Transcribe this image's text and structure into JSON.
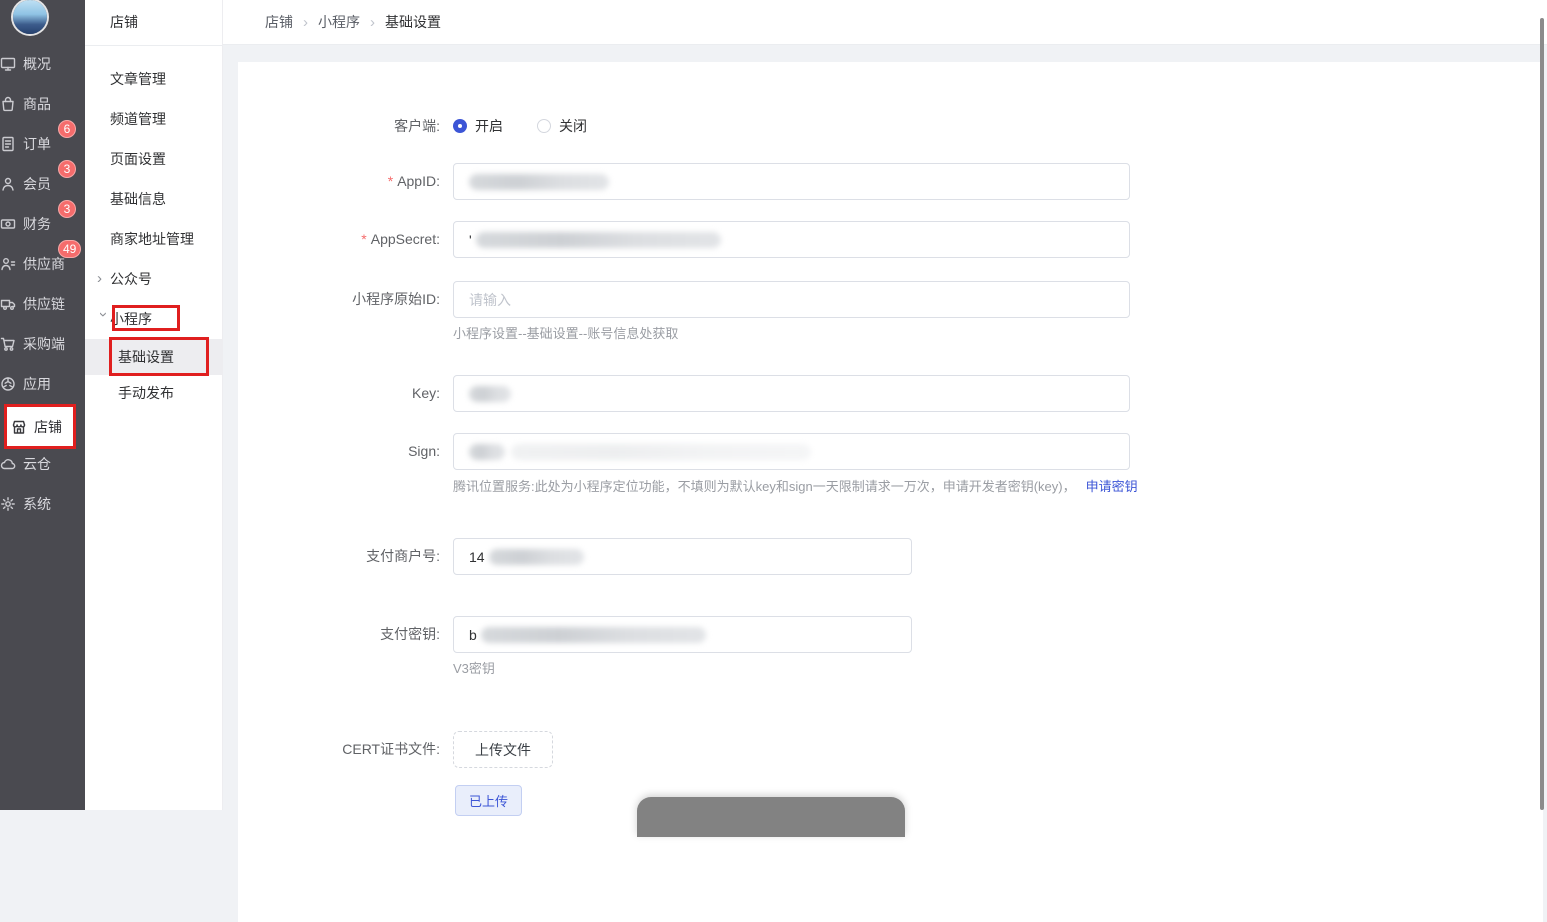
{
  "colors": {
    "accent_blue": "#3c55d6",
    "annotation_red": "#e01f1f",
    "badge_red": "#f56c6c",
    "sidebar_dark": "#4a4a50",
    "page_background": "#f0f2f5"
  },
  "glyphs": {
    "chevron": "›"
  },
  "sidebar": {
    "items": [
      {
        "label": "概况"
      },
      {
        "label": "商品"
      },
      {
        "label": "订单",
        "badge": "6"
      },
      {
        "label": "会员",
        "badge": "3"
      },
      {
        "label": "财务",
        "badge": "3"
      },
      {
        "label": "供应商",
        "badge": "49"
      },
      {
        "label": "供应链"
      },
      {
        "label": "采购端"
      },
      {
        "label": "应用"
      },
      {
        "label": "店铺"
      },
      {
        "label": "云仓"
      },
      {
        "label": "系统"
      }
    ]
  },
  "submenu": {
    "title": "店铺",
    "items": [
      "文章管理",
      "频道管理",
      "页面设置",
      "基础信息",
      "商家地址管理",
      "公众号",
      "小程序",
      "基础设置",
      "手动发布"
    ]
  },
  "breadcrumb": {
    "items": [
      "店铺",
      "小程序",
      "基础设置"
    ]
  },
  "form": {
    "client": {
      "label": "客户端:",
      "on": "开启",
      "off": "关闭"
    },
    "appid": {
      "label": "AppID:",
      "required": "*"
    },
    "appsecret": {
      "label": "AppSecret:",
      "required": "*",
      "value_prefix": "'"
    },
    "original_id": {
      "label": "小程序原始ID:",
      "placeholder": "请输入",
      "help": "小程序设置--基础设置--账号信息处获取"
    },
    "key": {
      "label": "Key:"
    },
    "sign": {
      "label": "Sign:",
      "help": "腾讯位置服务:此处为小程序定位功能，不填则为默认key和sign一天限制请求一万次，申请开发者密钥(key)，",
      "link": "申请密钥"
    },
    "merchant_id": {
      "label": "支付商户号:",
      "value_prefix": "14"
    },
    "pay_secret": {
      "label": "支付密钥:",
      "value_prefix": "b",
      "help": "V3密钥"
    },
    "cert": {
      "label": "CERT证书文件:",
      "upload_label": "上传文件",
      "status": "已上传"
    }
  }
}
